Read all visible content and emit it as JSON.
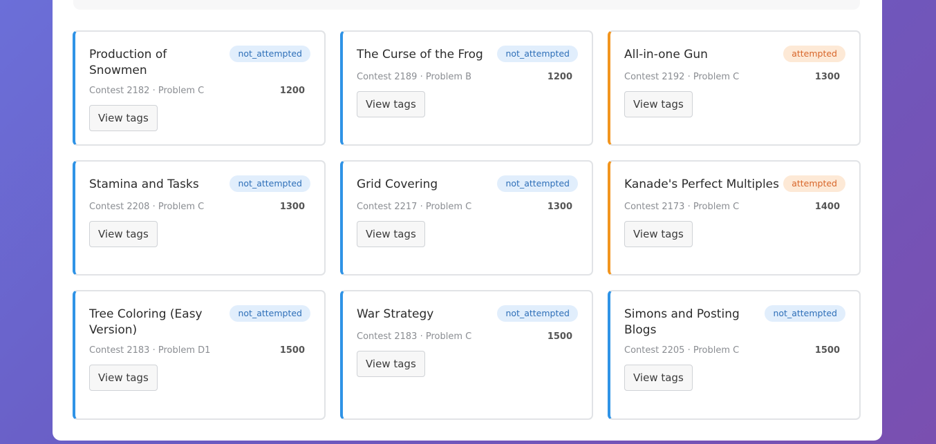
{
  "view_tags_label": "View tags",
  "cards": [
    {
      "title": "Production of Snowmen",
      "status": "not_attempted",
      "meta": "Contest 2182 · Problem C",
      "rating": "1200"
    },
    {
      "title": "The Curse of the Frog",
      "status": "not_attempted",
      "meta": "Contest 2189 · Problem B",
      "rating": "1200"
    },
    {
      "title": "All-in-one Gun",
      "status": "attempted",
      "meta": "Contest 2192 · Problem C",
      "rating": "1300"
    },
    {
      "title": "Stamina and Tasks",
      "status": "not_attempted",
      "meta": "Contest 2208 · Problem C",
      "rating": "1300"
    },
    {
      "title": "Grid Covering",
      "status": "not_attempted",
      "meta": "Contest 2217 · Problem C",
      "rating": "1300"
    },
    {
      "title": "Kanade's Perfect Multiples",
      "status": "attempted",
      "meta": "Contest 2173 · Problem C",
      "rating": "1400"
    },
    {
      "title": "Tree Coloring (Easy Version)",
      "status": "not_attempted",
      "meta": "Contest 2183 · Problem D1",
      "rating": "1500"
    },
    {
      "title": "War Strategy",
      "status": "not_attempted",
      "meta": "Contest 2183 · Problem C",
      "rating": "1500"
    },
    {
      "title": "Simons and Posting Blogs",
      "status": "not_attempted",
      "meta": "Contest 2205 · Problem C",
      "rating": "1500"
    }
  ],
  "colors": {
    "not_attempted_accent": "#2f93e6",
    "attempted_accent": "#f2951f",
    "not_attempted_badge_bg": "#e1eefc",
    "attempted_badge_bg": "#fde9d6"
  }
}
